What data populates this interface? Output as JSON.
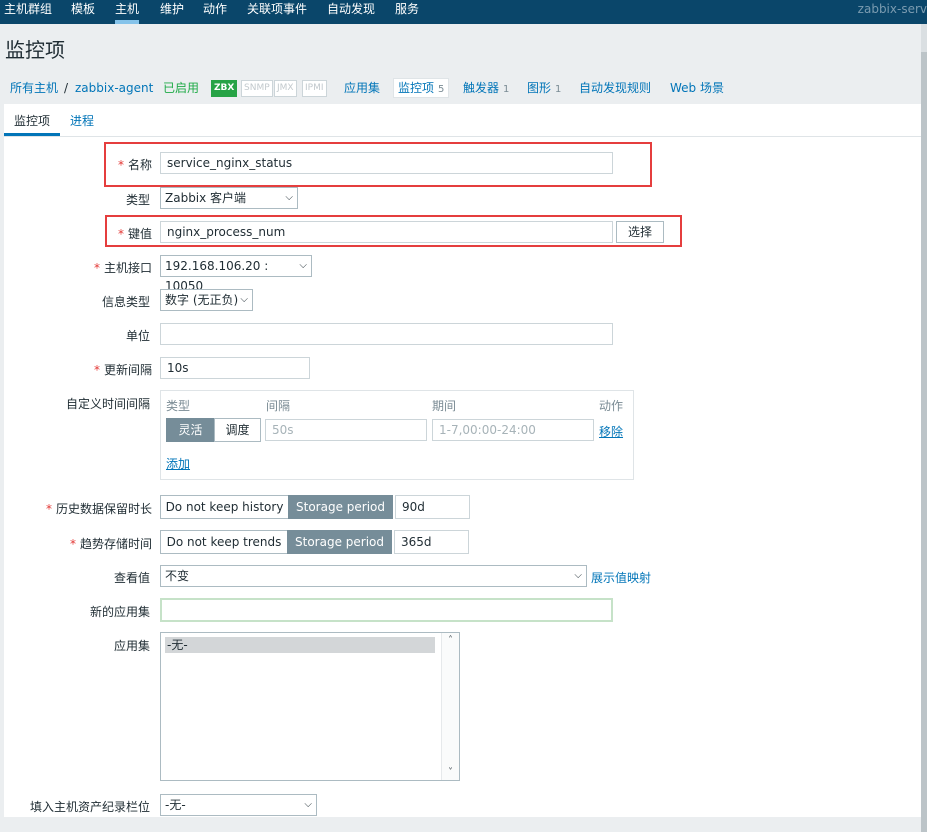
{
  "topnav": {
    "items": [
      "主机群组",
      "模板",
      "主机",
      "维护",
      "动作",
      "关联项事件",
      "自动发现",
      "服务"
    ],
    "brand": "zabbix-serv"
  },
  "page_title": "监控项",
  "breadcrumb": {
    "all_hosts": "所有主机",
    "separator": "/",
    "host": "zabbix-agent",
    "status": "已启用",
    "protocols": [
      "ZBX",
      "SNMP",
      "JMX",
      "IPMI"
    ],
    "links": {
      "applications": "应用集",
      "items": "监控项",
      "items_count": "5",
      "triggers": "触发器",
      "triggers_count": "1",
      "graphs": "图形",
      "graphs_count": "1",
      "discovery": "自动发现规则",
      "web": "Web 场景"
    }
  },
  "tabs": [
    "监控项",
    "进程"
  ],
  "form": {
    "required_mark": "*",
    "name": {
      "label": "名称",
      "value": "service_nginx_status"
    },
    "type": {
      "label": "类型",
      "value": "Zabbix 客户端"
    },
    "key": {
      "label": "键值",
      "value": "nginx_process_num",
      "button": "选择"
    },
    "interface": {
      "label": "主机接口",
      "value": "192.168.106.20 : 10050"
    },
    "info_type": {
      "label": "信息类型",
      "value": "数字 (无正负)"
    },
    "units": {
      "label": "单位",
      "value": ""
    },
    "update_interval": {
      "label": "更新间隔",
      "value": "10s"
    },
    "custom_intervals": {
      "label": "自定义时间间隔",
      "headers": [
        "类型",
        "间隔",
        "期间",
        "动作"
      ],
      "modes": [
        "灵活",
        "调度"
      ],
      "interval_placeholder": "50s",
      "period_placeholder": "1-7,00:00-24:00",
      "remove": "移除",
      "add": "添加"
    },
    "history": {
      "label": "历史数据保留时长",
      "off": "Do not keep history",
      "on": "Storage period",
      "value": "90d"
    },
    "trends": {
      "label": "趋势存储时间",
      "off": "Do not keep trends",
      "on": "Storage period",
      "value": "365d"
    },
    "valuemap": {
      "label": "查看值",
      "value": "不变",
      "link": "展示值映射"
    },
    "new_app": {
      "label": "新的应用集",
      "value": ""
    },
    "apps": {
      "label": "应用集",
      "selected": "-无-"
    },
    "inventory": {
      "label": "填入主机资产纪录栏位",
      "value": "-无-"
    }
  },
  "colors": {
    "nav": "#0a466a",
    "link": "#0275b8",
    "enabled": "#1fab47",
    "highlight": "#e53e3e",
    "segment_on": "#768d99"
  }
}
